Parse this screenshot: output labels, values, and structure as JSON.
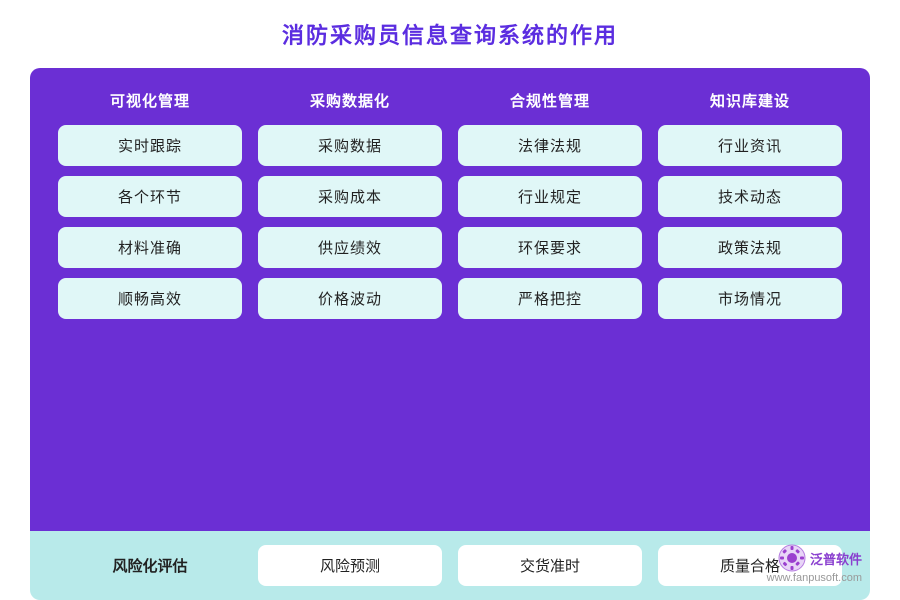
{
  "title": "消防采购员信息查询系统的作用",
  "columns": [
    {
      "label": "可视化管理"
    },
    {
      "label": "采购数据化"
    },
    {
      "label": "合规性管理"
    },
    {
      "label": "知识库建设"
    }
  ],
  "rows": [
    [
      {
        "text": "实时跟踪"
      },
      {
        "text": "采购数据"
      },
      {
        "text": "法律法规"
      },
      {
        "text": "行业资讯"
      }
    ],
    [
      {
        "text": "各个环节"
      },
      {
        "text": "采购成本"
      },
      {
        "text": "行业规定"
      },
      {
        "text": "技术动态"
      }
    ],
    [
      {
        "text": "材料准确"
      },
      {
        "text": "供应绩效"
      },
      {
        "text": "环保要求"
      },
      {
        "text": "政策法规"
      }
    ],
    [
      {
        "text": "顺畅高效"
      },
      {
        "text": "价格波动"
      },
      {
        "text": "严格把控"
      },
      {
        "text": "市场情况"
      }
    ]
  ],
  "bottom": {
    "label": "风险化评估",
    "items": [
      "风险预测",
      "交货准时",
      "质量合格"
    ]
  },
  "watermark": {
    "brand": "泛普软件",
    "url": "www.fanpusoft.com"
  }
}
